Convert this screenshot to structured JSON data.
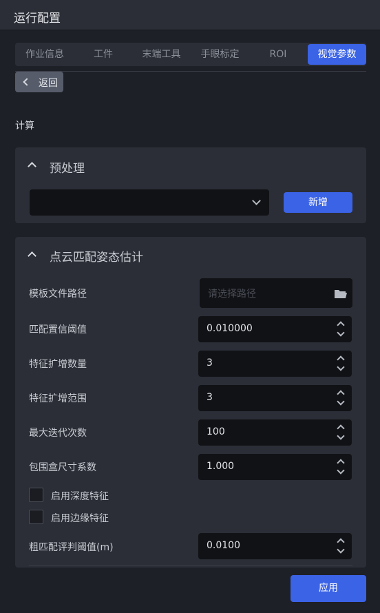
{
  "window": {
    "title": "运行配置"
  },
  "tabs": [
    "作业信息",
    "工件",
    "末端工具",
    "手眼标定",
    "ROI",
    "视觉参数"
  ],
  "active_tab": "视觉参数",
  "back_label": "返回",
  "section_label": "计算",
  "preprocess": {
    "title": "预处理",
    "select_value": "",
    "add_label": "新增"
  },
  "pose": {
    "title": "点云匹配姿态估计",
    "template_path_label": "模板文件路径",
    "template_path_placeholder": "请选择路径",
    "fields": [
      {
        "label": "匹配置信阈值",
        "value": "0.010000"
      },
      {
        "label": "特征扩增数量",
        "value": "3"
      },
      {
        "label": "特征扩增范围",
        "value": "3"
      },
      {
        "label": "最大迭代次数",
        "value": "100"
      },
      {
        "label": "包围盒尺寸系数",
        "value": "1.000"
      }
    ],
    "checkboxes": [
      {
        "label": "启用深度特征",
        "checked": false
      },
      {
        "label": "启用边缘特征",
        "checked": false
      }
    ],
    "coarse_threshold": {
      "label": "粗匹配评判阈值(m)",
      "value": "0.0100"
    }
  },
  "apply_label": "应用",
  "colors": {
    "accent": "#3b63e6",
    "panel": "#2b2e36",
    "input": "#111216",
    "background": "#1e2027"
  }
}
